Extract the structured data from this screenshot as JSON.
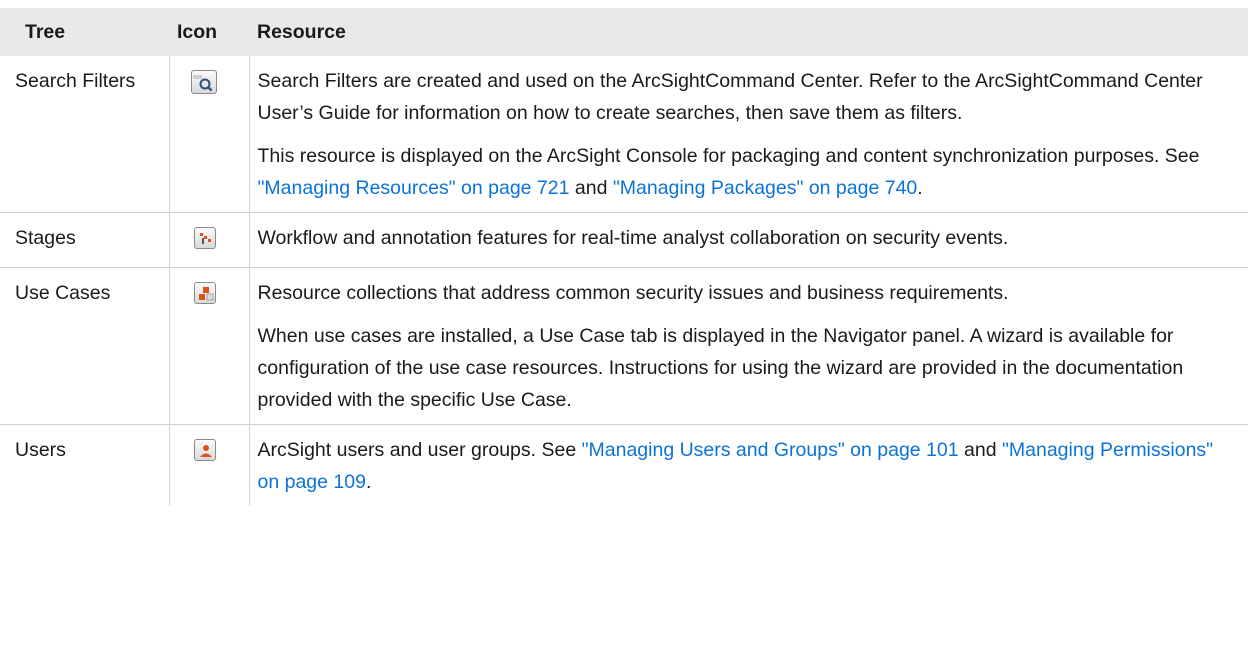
{
  "headers": {
    "tree": "Tree",
    "icon": "Icon",
    "resource": "Resource"
  },
  "rows": [
    {
      "tree": "Search Filters",
      "icon": "search-filter-icon",
      "p1": "Search Filters are created and used on the ArcSightCommand Center. Refer to the ArcSightCommand Center User’s Guide for information on how to create searches, then save them as filters.",
      "p2_prefix": "This resource is displayed on the ArcSight Console for packaging and content synchronization purposes. See ",
      "p2_link1": "\"Managing Resources\" on page 721",
      "p2_mid": " and ",
      "p2_link2": "\"Managing Packages\" on page 740",
      "p2_suffix": "."
    },
    {
      "tree": "Stages",
      "icon": "stages-icon",
      "p1": "Workflow and annotation features for real-time analyst collaboration on security events."
    },
    {
      "tree": "Use Cases",
      "icon": "use-cases-icon",
      "p1": "Resource collections that address common security issues and business requirements.",
      "p2": "When use cases are installed, a Use Case tab is displayed in the Navigator panel. A wizard is available for configuration of the use case resources. Instructions for using the wizard are provided in the documentation provided with the specific Use Case."
    },
    {
      "tree": "Users",
      "icon": "users-icon",
      "p1_prefix": "ArcSight users and user groups. See ",
      "p1_link1": "\"Managing Users and Groups\" on page 101",
      "p1_mid": " and ",
      "p1_link2": "\"Managing Permissions\" on page 109",
      "p1_suffix": "."
    }
  ],
  "colors": {
    "link": "#0b73d8",
    "header_bg": "#e9e9e9",
    "icon_accent": "#e0501c"
  }
}
